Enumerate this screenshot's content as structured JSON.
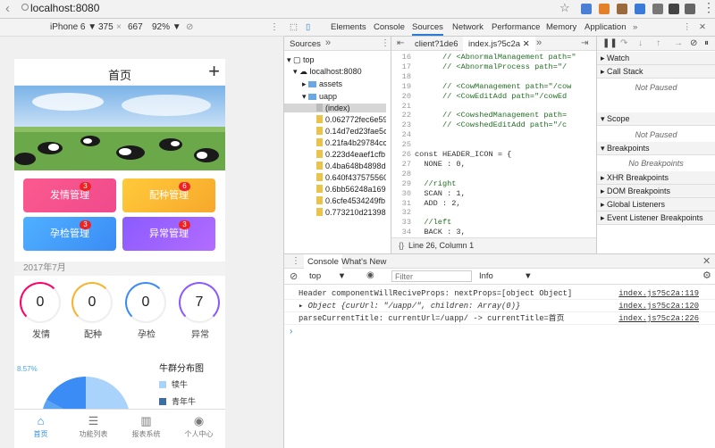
{
  "browser": {
    "url": "localhost:8080"
  },
  "devicebar": {
    "device": "iPhone 6 ▼",
    "width": "375",
    "height": "667",
    "zoom": "92% ▼"
  },
  "phone": {
    "title": "首页",
    "tiles": [
      {
        "label": "发情管理",
        "badge": "3"
      },
      {
        "label": "配种管理",
        "badge": "6"
      },
      {
        "label": "孕检管理",
        "badge": "3"
      },
      {
        "label": "异常管理",
        "badge": "3"
      }
    ],
    "month": "2017年7月",
    "stats": [
      {
        "value": "0",
        "label": "发情"
      },
      {
        "value": "0",
        "label": "配种"
      },
      {
        "value": "0",
        "label": "孕检"
      },
      {
        "value": "7",
        "label": "异常"
      }
    ],
    "chart_title": "牛群分布图",
    "chart_pct": "8.57%",
    "legend": [
      "犊牛",
      "青年牛"
    ],
    "tabs": [
      "首页",
      "功能列表",
      "报表系统",
      "个人中心"
    ]
  },
  "chart_data": {
    "type": "pie",
    "title": "牛群分布图",
    "labels": [
      "犊牛",
      "青年牛"
    ],
    "visible_percent_label": "8.57%"
  },
  "devtools": {
    "tabs": [
      "Elements",
      "Console",
      "Sources",
      "Network",
      "Performance",
      "Memory",
      "Application"
    ],
    "navigator_tab": "Sources",
    "tree": [
      "top",
      "localhost:8080",
      "assets",
      "uapp",
      "(index)",
      "0.062772fec6e59",
      "0.14d7ed23fae5c",
      "0.21fa4b29784cc",
      "0.223d4eaef1cfb",
      "0.4ba648b4898d",
      "0.640f437575560",
      "0.6bb56248a169",
      "0.6cfe4534249fb",
      "0.773210d21398"
    ],
    "editor_tabs": [
      "client?1de6",
      "index.js?5c2a"
    ],
    "code": [
      {
        "no": "16",
        "text": "      // <AbnormalManagement path=\"",
        "c": true
      },
      {
        "no": "17",
        "text": "      // <AbnormalProcess path=\"/",
        "c": true
      },
      {
        "no": "18",
        "text": "",
        "c": false
      },
      {
        "no": "19",
        "text": "      // <CowManagement path=\"/cow",
        "c": true
      },
      {
        "no": "20",
        "text": "      // <CowEditAdd path=\"/cowEd",
        "c": true
      },
      {
        "no": "21",
        "text": "",
        "c": false
      },
      {
        "no": "22",
        "text": "      // <CowshedManagement path=",
        "c": true
      },
      {
        "no": "23",
        "text": "      // <CowshedEditAdd path=\"/c",
        "c": true
      },
      {
        "no": "24",
        "text": "",
        "c": false
      },
      {
        "no": "25",
        "text": "",
        "c": false
      },
      {
        "no": "26",
        "text": "const HEADER_ICON = {",
        "c": false
      },
      {
        "no": "27",
        "text": "  NONE : 0,",
        "c": false
      },
      {
        "no": "28",
        "text": "",
        "c": false
      },
      {
        "no": "29",
        "text": "  //right",
        "c": true
      },
      {
        "no": "30",
        "text": "  SCAN : 1,",
        "c": false
      },
      {
        "no": "31",
        "text": "  ADD : 2,",
        "c": false
      },
      {
        "no": "32",
        "text": "",
        "c": false
      },
      {
        "no": "33",
        "text": "  //left",
        "c": true
      },
      {
        "no": "34",
        "text": "  BACK : 3,",
        "c": false
      }
    ],
    "cursor": "Line 26, Column 1",
    "side": [
      {
        "label": "▸ Watch"
      },
      {
        "label": "▸ Call Stack",
        "info": "Not Paused"
      },
      {
        "label": "▾ Scope",
        "info": "Not Paused"
      },
      {
        "label": "▾ Breakpoints",
        "info": "No Breakpoints"
      },
      {
        "label": "▸ XHR Breakpoints"
      },
      {
        "label": "▸ DOM Breakpoints"
      },
      {
        "label": "▸ Global Listeners"
      },
      {
        "label": "▸ Event Listener Breakpoints"
      }
    ],
    "console_tabs": [
      "Console",
      "What's New"
    ],
    "context": "top",
    "filter_placeholder": "Filter",
    "level": "Info",
    "logs": [
      {
        "text": "Header componentWillReciveProps: nextProps=[object Object]",
        "src": "index.js?5c2a:119"
      },
      {
        "text": "▸ Object {curUrl: \"/uapp/\", children: Array(0)}",
        "src": "index.js?5c2a:120"
      },
      {
        "text": "parseCurrentTitle: currentUrl=/uapp/ -> currentTitle=首页",
        "src": "index.js?5c2a:226"
      }
    ]
  }
}
